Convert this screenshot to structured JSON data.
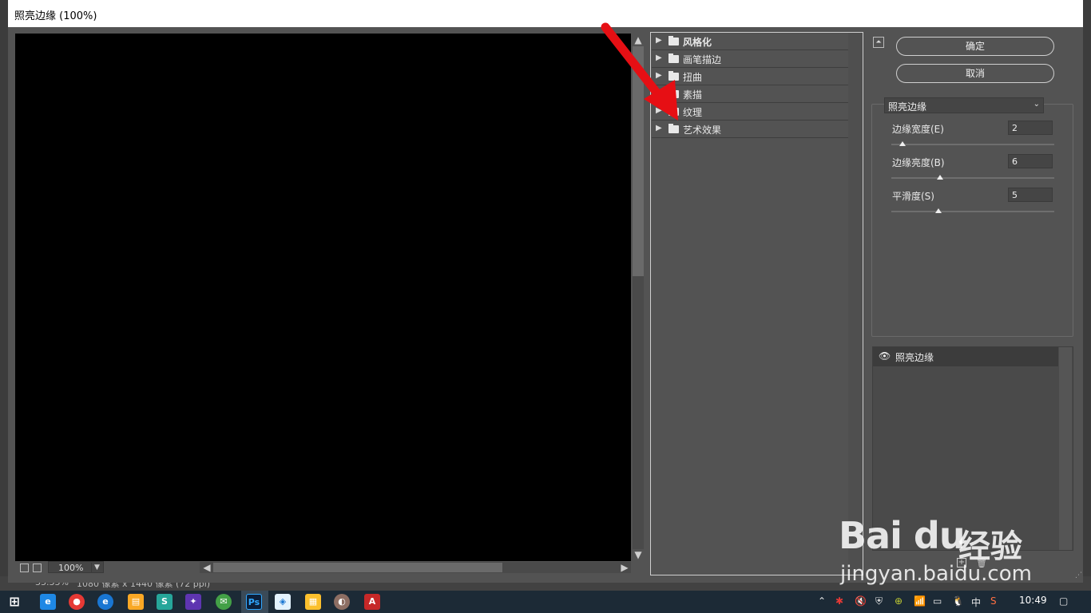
{
  "dialog": {
    "title": "照亮边缘 (100%)"
  },
  "preview": {
    "zoom": "100%"
  },
  "status_bar": {
    "zoom": "33.33%",
    "doc_info": "1080 像素 x 1440 像素 (72 ppi)"
  },
  "filter_categories": [
    {
      "label": "风格化",
      "bold": true
    },
    {
      "label": "画笔描边"
    },
    {
      "label": "扭曲"
    },
    {
      "label": "素描"
    },
    {
      "label": "纹理"
    },
    {
      "label": "艺术效果"
    }
  ],
  "buttons": {
    "ok": "确定",
    "cancel": "取消"
  },
  "settings": {
    "selected_filter": "照亮边缘",
    "params": [
      {
        "label": "边缘宽度(E)",
        "value": "2",
        "slider": 0.07
      },
      {
        "label": "边缘亮度(B)",
        "value": "6",
        "slider": 0.3
      },
      {
        "label": "平滑度(S)",
        "value": "5",
        "slider": 0.29
      }
    ]
  },
  "effect_layers": [
    {
      "label": "照亮边缘"
    }
  ],
  "watermark": {
    "logo": "Bai du",
    "cn": "经验",
    "url": "jingyan.baidu.com"
  },
  "taskbar": {
    "clock": "10:49",
    "ime": "中",
    "icons": [
      "start-icon",
      "ie-icon",
      "chrome-icon",
      "edge-icon",
      "explorer-icon",
      "wps-icon",
      "app-icon",
      "wechat-icon",
      "photoshop-icon",
      "app2-icon",
      "app3-icon",
      "app4-icon",
      "acrobat-icon"
    ]
  },
  "colors": {
    "dialog_bg": "#535353",
    "preview_bg": "#000000",
    "accent_arrow": "#e60f14",
    "taskbar": "#1c2a36"
  }
}
